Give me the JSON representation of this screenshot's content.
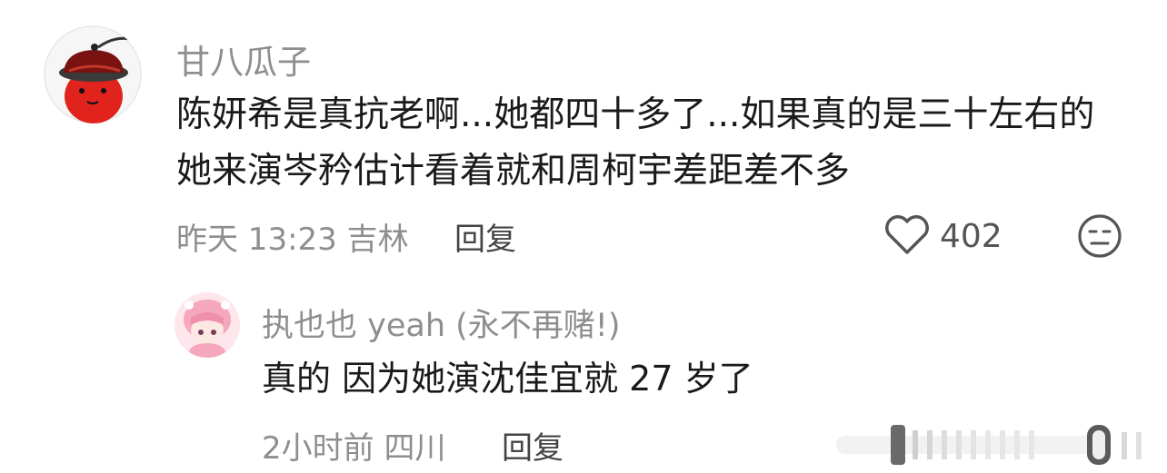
{
  "comments": [
    {
      "username": "甘八瓜子",
      "avatar_icon": "red-face-hat-icon",
      "text": "陈妍希是真抗老啊...她都四十多了...如果真的是三十左右的她来演岑矜估计看着就和周柯宇差距差不多",
      "date": "昨天 13:23",
      "location": "吉林",
      "reply_label": "回复",
      "likes": "402",
      "reaction_icon": "neutral-face-icon",
      "like_icon": "heart-outline-icon"
    }
  ],
  "replies": [
    {
      "username": "执也也 yeah (永不再赌!)",
      "avatar_icon": "pink-anime-girl-icon",
      "text": "真的 因为她演沈佳宜就 27 岁了",
      "date": "2小时前",
      "location": "四川",
      "reply_label": "回复"
    }
  ],
  "colors": {
    "accent_red": "#e0231d",
    "text": "#1a1a1a",
    "meta": "#8e8e8e"
  }
}
